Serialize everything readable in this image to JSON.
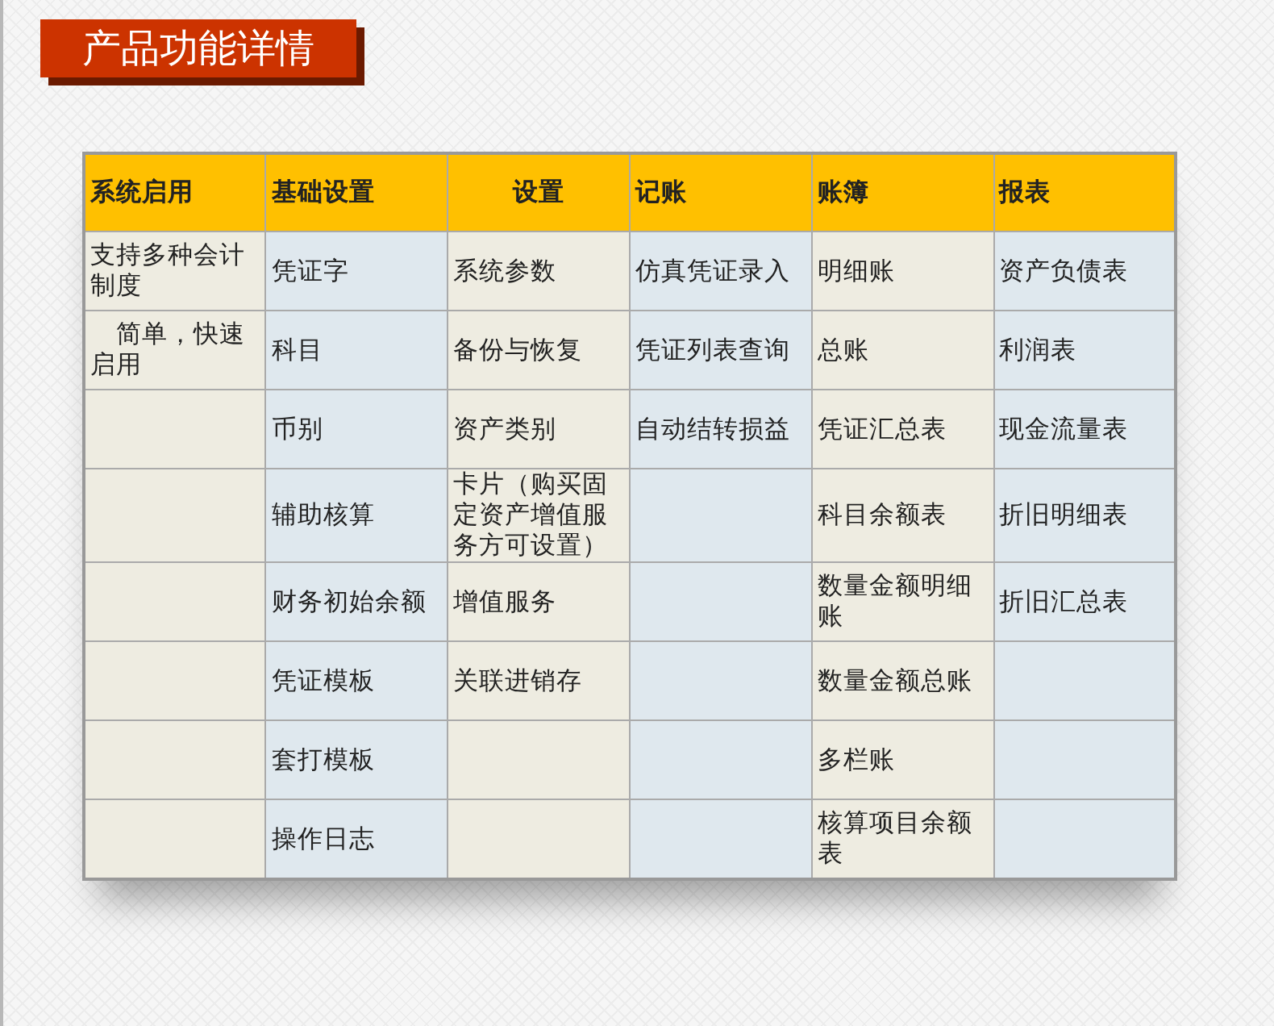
{
  "title": "产品功能详情",
  "table": {
    "columns": [
      {
        "label": "系统启用",
        "centered": false
      },
      {
        "label": "基础设置",
        "centered": false
      },
      {
        "label": "设置",
        "centered": true
      },
      {
        "label": "记账",
        "centered": false
      },
      {
        "label": "账簿",
        "centered": false
      },
      {
        "label": "报表",
        "centered": false
      }
    ],
    "rows": [
      {
        "cells": [
          "支持多种会计制度",
          "凭证字",
          "系统参数",
          "仿真凭证录入",
          "明细账",
          "资产负债表"
        ]
      },
      {
        "cells": [
          "　简单，快速启用",
          "科目",
          "备份与恢复",
          "凭证列表查询",
          "总账",
          "利润表"
        ]
      },
      {
        "cells": [
          null,
          "币别",
          "资产类别",
          "自动结转损益",
          "凭证汇总表",
          "现金流量表"
        ]
      },
      {
        "cells": [
          null,
          "辅助核算",
          "卡片（购买固定资产增值服务方可设置）",
          null,
          "科目余额表",
          "折旧明细表"
        ]
      },
      {
        "cells": [
          null,
          "财务初始余额",
          "增值服务",
          null,
          "数量金额明细账",
          "折旧汇总表"
        ]
      },
      {
        "cells": [
          null,
          "凭证模板",
          "关联进销存",
          null,
          "数量金额总账",
          null
        ]
      },
      {
        "cells": [
          null,
          "套打模板",
          null,
          null,
          "多栏账",
          null
        ]
      },
      {
        "cells": [
          null,
          "操作日志",
          null,
          null,
          "核算项目余额表",
          null
        ]
      }
    ]
  }
}
